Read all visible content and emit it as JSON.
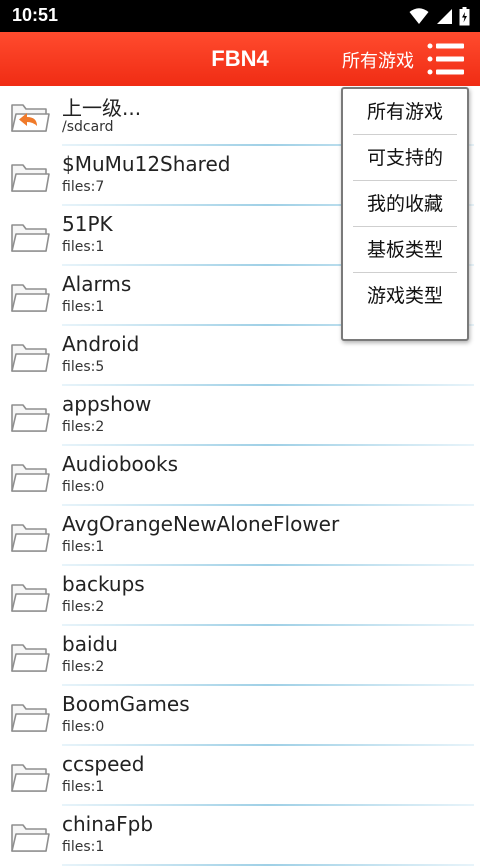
{
  "status": {
    "time": "10:51"
  },
  "app": {
    "title": "FBN4",
    "filter_label": "所有游戏"
  },
  "menu": {
    "items": [
      "所有游戏",
      "可支持的",
      "我的收藏",
      "基板类型",
      "游戏类型"
    ]
  },
  "files": [
    {
      "name": "上一级...",
      "sub": "/sdcard",
      "icon": "folder-up-icon"
    },
    {
      "name": "$MuMu12Shared",
      "sub": "files:7",
      "icon": "folder-icon"
    },
    {
      "name": "51PK",
      "sub": "files:1",
      "icon": "folder-icon"
    },
    {
      "name": "Alarms",
      "sub": "files:1",
      "icon": "folder-icon"
    },
    {
      "name": "Android",
      "sub": "files:5",
      "icon": "folder-icon"
    },
    {
      "name": "appshow",
      "sub": "files:2",
      "icon": "folder-icon"
    },
    {
      "name": "Audiobooks",
      "sub": "files:0",
      "icon": "folder-icon"
    },
    {
      "name": "AvgOrangeNewAloneFlower",
      "sub": "files:1",
      "icon": "folder-icon"
    },
    {
      "name": "backups",
      "sub": "files:2",
      "icon": "folder-icon"
    },
    {
      "name": "baidu",
      "sub": "files:2",
      "icon": "folder-icon"
    },
    {
      "name": "BoomGames",
      "sub": "files:0",
      "icon": "folder-icon"
    },
    {
      "name": "ccspeed",
      "sub": "files:1",
      "icon": "folder-icon"
    },
    {
      "name": "chinaFpb",
      "sub": "files:1",
      "icon": "folder-icon"
    }
  ],
  "colors": {
    "app_bar": "#f02c14",
    "divider": "#9fd0e6",
    "folder": "#8f8f8f",
    "up_arrow": "#f07a2a"
  }
}
